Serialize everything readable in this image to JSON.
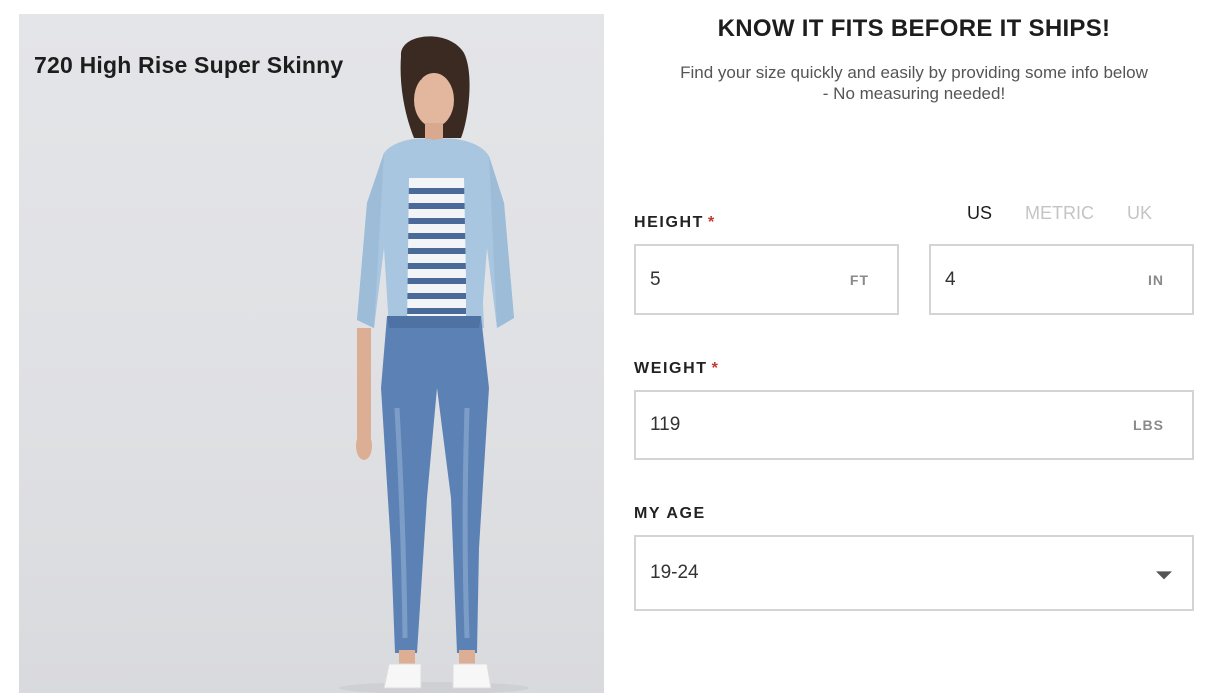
{
  "product": {
    "title": "720 High Rise Super Skinny"
  },
  "fit_form": {
    "headline": "KNOW IT FITS BEFORE IT SHIPS!",
    "subhead_line1": "Find your size quickly and easily by providing some info below",
    "subhead_line2": "- No measuring needed!",
    "height": {
      "label": "HEIGHT",
      "required_mark": "*",
      "feet_value": "5",
      "feet_unit": "FT",
      "inches_value": "4",
      "inches_unit": "IN"
    },
    "unit_system": {
      "options": [
        "US",
        "METRIC",
        "UK"
      ],
      "selected": "US"
    },
    "weight": {
      "label": "WEIGHT",
      "required_mark": "*",
      "value": "119",
      "unit": "LBS"
    },
    "age": {
      "label": "MY AGE",
      "selected": "19-24"
    }
  },
  "colors": {
    "required": "#c0392b",
    "unit_inactive": "#c4c4c4",
    "border": "#d4d4d4"
  }
}
